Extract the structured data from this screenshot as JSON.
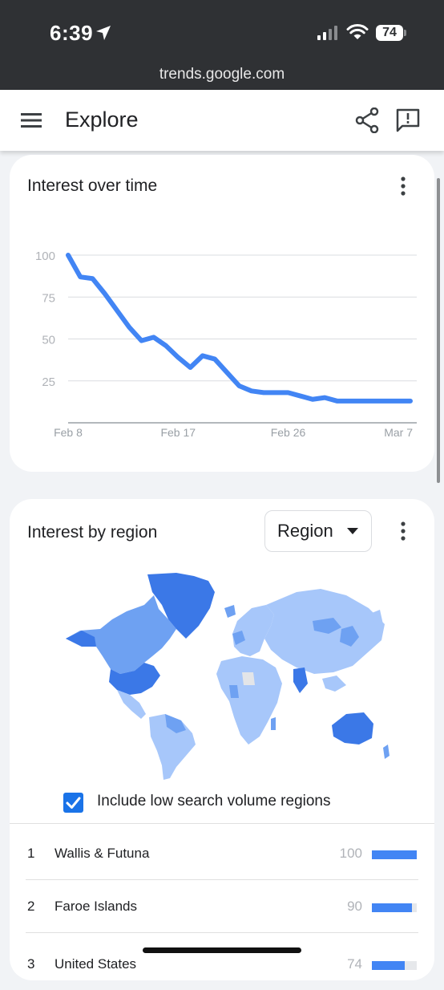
{
  "status_bar": {
    "time": "6:39",
    "battery": "74",
    "url": "trends.google.com"
  },
  "app_bar": {
    "title": "Explore",
    "icons": [
      "menu-icon",
      "share-icon",
      "feedback-icon"
    ]
  },
  "interest_over_time": {
    "title": "Interest over time",
    "chart_data": {
      "type": "line",
      "ylim": [
        0,
        100
      ],
      "y_ticks": [
        "25",
        "50",
        "75",
        "100"
      ],
      "x_tick_labels": [
        "Feb 8",
        "Feb 17",
        "Feb 26",
        "Mar 7"
      ],
      "x": [
        "Feb 8",
        "Feb 9",
        "Feb 10",
        "Feb 11",
        "Feb 12",
        "Feb 13",
        "Feb 14",
        "Feb 15",
        "Feb 16",
        "Feb 17",
        "Feb 18",
        "Feb 19",
        "Feb 20",
        "Feb 21",
        "Feb 22",
        "Feb 23",
        "Feb 24",
        "Feb 25",
        "Feb 26",
        "Feb 27",
        "Feb 28",
        "Feb 29",
        "Mar 1",
        "Mar 2",
        "Mar 3",
        "Mar 4",
        "Mar 5",
        "Mar 6",
        "Mar 7"
      ],
      "series": [
        {
          "color": "#4285f4",
          "values": [
            100,
            87,
            86,
            77,
            67,
            57,
            49,
            51,
            46,
            39,
            33,
            40,
            38,
            30,
            22,
            19,
            18,
            18,
            18,
            16,
            14,
            15,
            13,
            13,
            13,
            13,
            13,
            13,
            13
          ]
        }
      ],
      "grid": true,
      "gridline_color": "#dadce0"
    }
  },
  "interest_by_region": {
    "title": "Interest by region",
    "select_value": "Region",
    "checkbox_label": "Include low search volume regions",
    "checkbox_checked": true,
    "rows": [
      {
        "rank": "1",
        "name": "Wallis & Futuna",
        "value": "100",
        "fraction": 1.0
      },
      {
        "rank": "2",
        "name": "Faroe Islands",
        "value": "90",
        "fraction": 0.9
      },
      {
        "rank": "3",
        "name": "United States",
        "value": "74",
        "fraction": 0.74
      }
    ],
    "map_colors": {
      "dark": "#3b78e7",
      "medium": "#6ea1f2",
      "light": "#a7c7fa",
      "no_data": "#e3e5e8"
    }
  }
}
